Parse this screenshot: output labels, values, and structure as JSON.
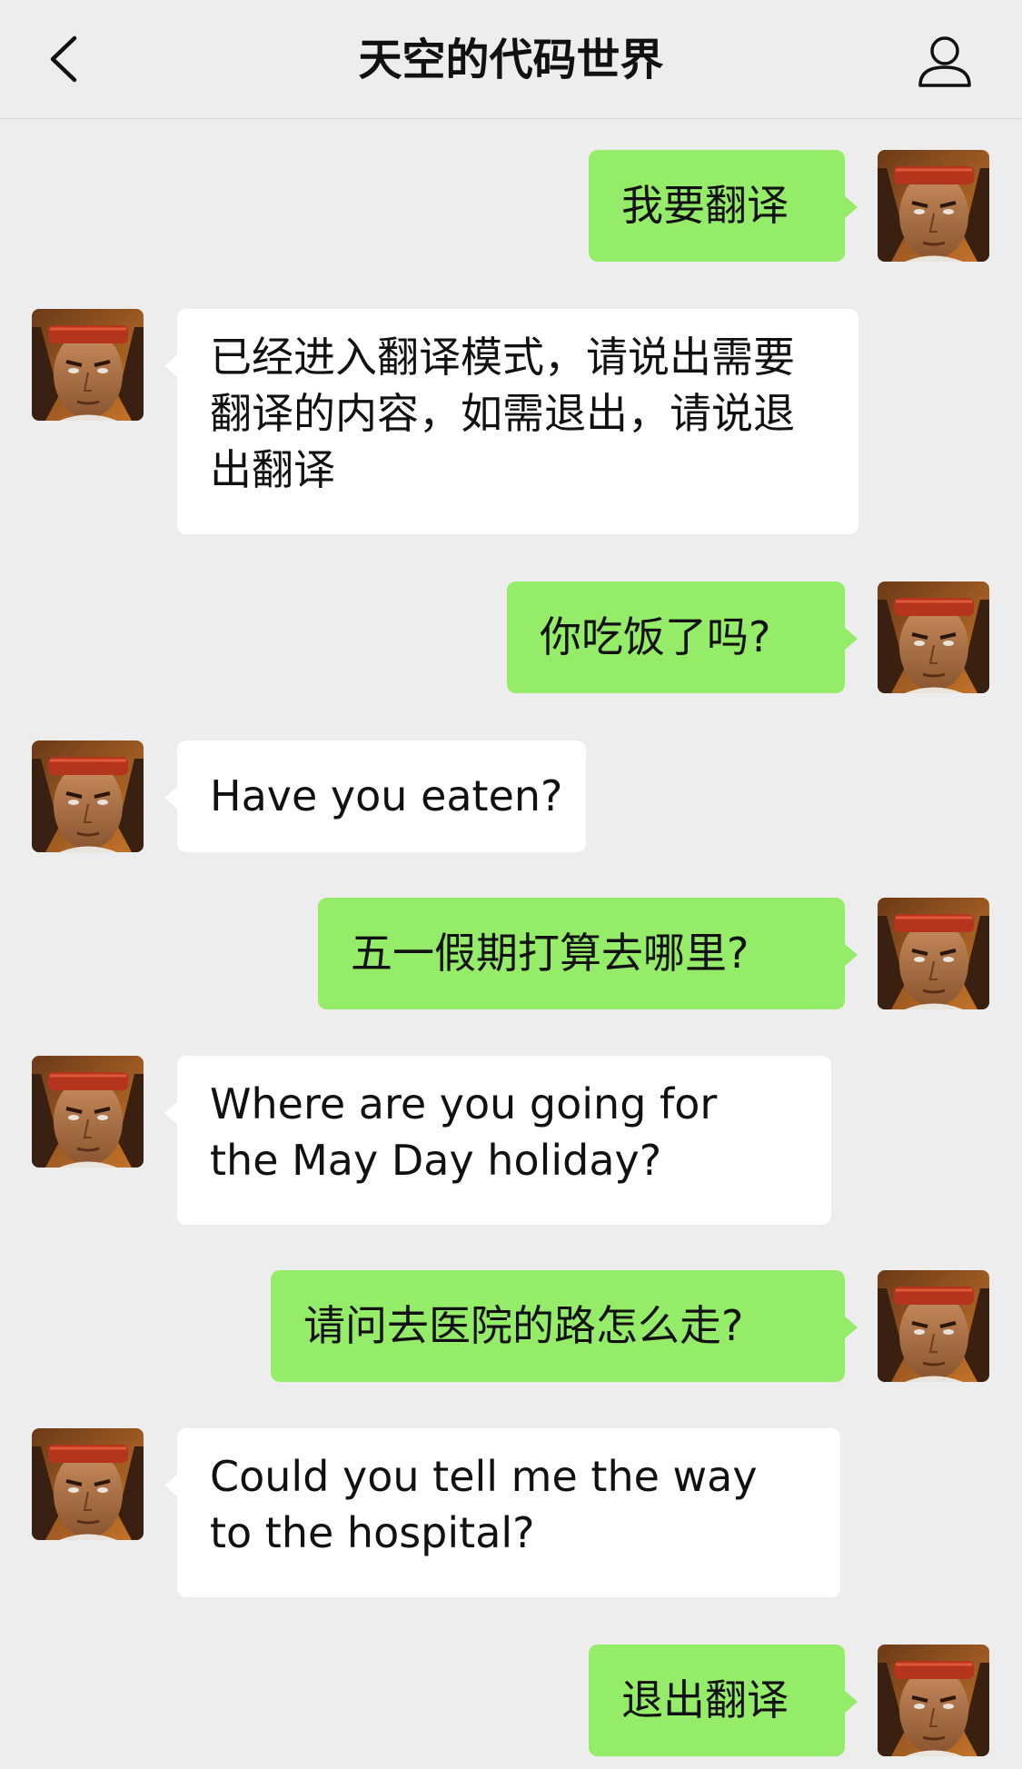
{
  "header": {
    "title": "天空的代码世界",
    "back_icon": "chevron-left-icon",
    "profile_icon": "user-icon"
  },
  "colors": {
    "background": "#ededed",
    "sent_bubble": "#95ec69",
    "received_bubble": "#ffffff"
  },
  "messages": [
    {
      "sender": "me",
      "text": "我要翻译"
    },
    {
      "sender": "other",
      "text": "已经进入翻译模式，请说出需要翻译的内容，如需退出，请说退出翻译"
    },
    {
      "sender": "me",
      "text": "你吃饭了吗?"
    },
    {
      "sender": "other",
      "text": "Have you eaten?"
    },
    {
      "sender": "me",
      "text": "五一假期打算去哪里?"
    },
    {
      "sender": "other",
      "text": "Where are you going for the May Day holiday?"
    },
    {
      "sender": "me",
      "text": "请问去医院的路怎么走?"
    },
    {
      "sender": "other",
      "text": "Could you tell me the way to the hospital?"
    },
    {
      "sender": "me",
      "text": "退出翻译"
    }
  ]
}
